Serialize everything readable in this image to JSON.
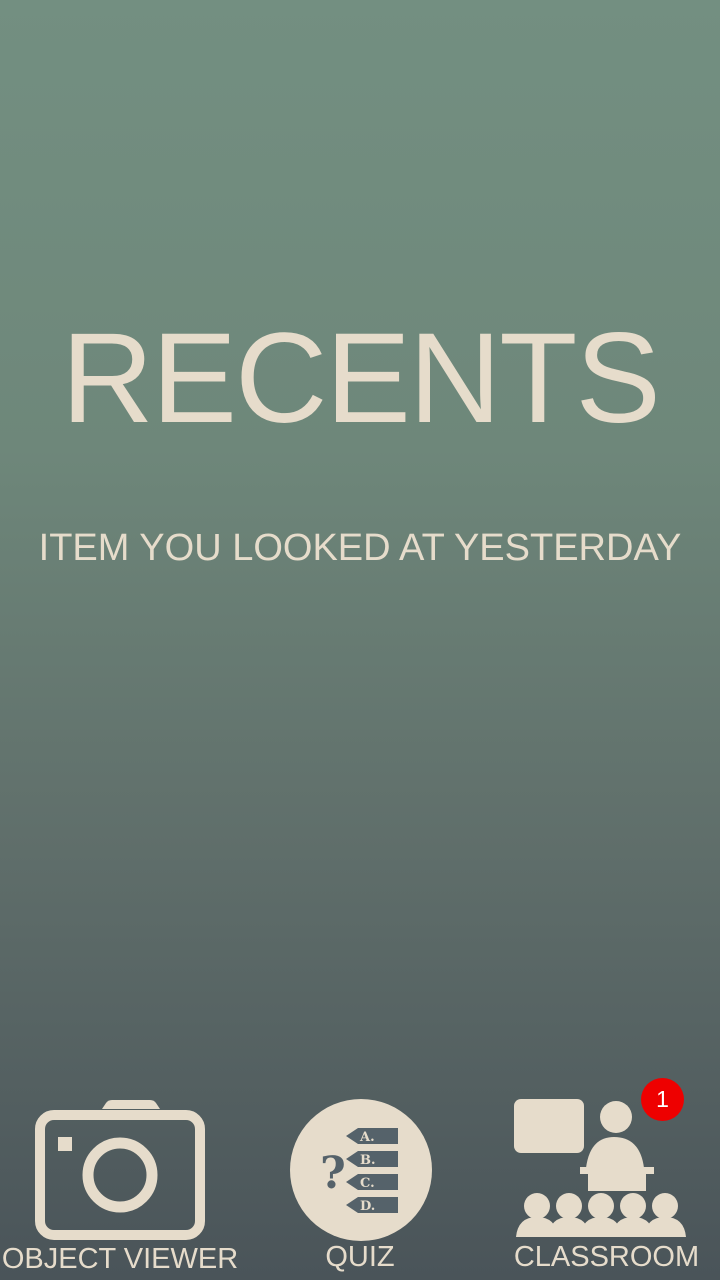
{
  "screen": {
    "title": "RECENTS",
    "recent_item": "ITEM YOU LOOKED AT YESTERDAY"
  },
  "bottom_nav": {
    "object_viewer": {
      "label": "OBJECT VIEWER",
      "icon": "camera-icon"
    },
    "quiz": {
      "label": "QUIZ",
      "icon": "quiz-icon",
      "icon_mark": "?",
      "options": [
        "A.",
        "B.",
        "C.",
        "D."
      ]
    },
    "classroom": {
      "label": "CLASSROOM",
      "icon": "classroom-icon",
      "badge": "1"
    }
  },
  "colors": {
    "text": "#e6dccb",
    "badge": "#ee0000",
    "background_top": "#738f81",
    "background_bottom": "#4a5459"
  }
}
